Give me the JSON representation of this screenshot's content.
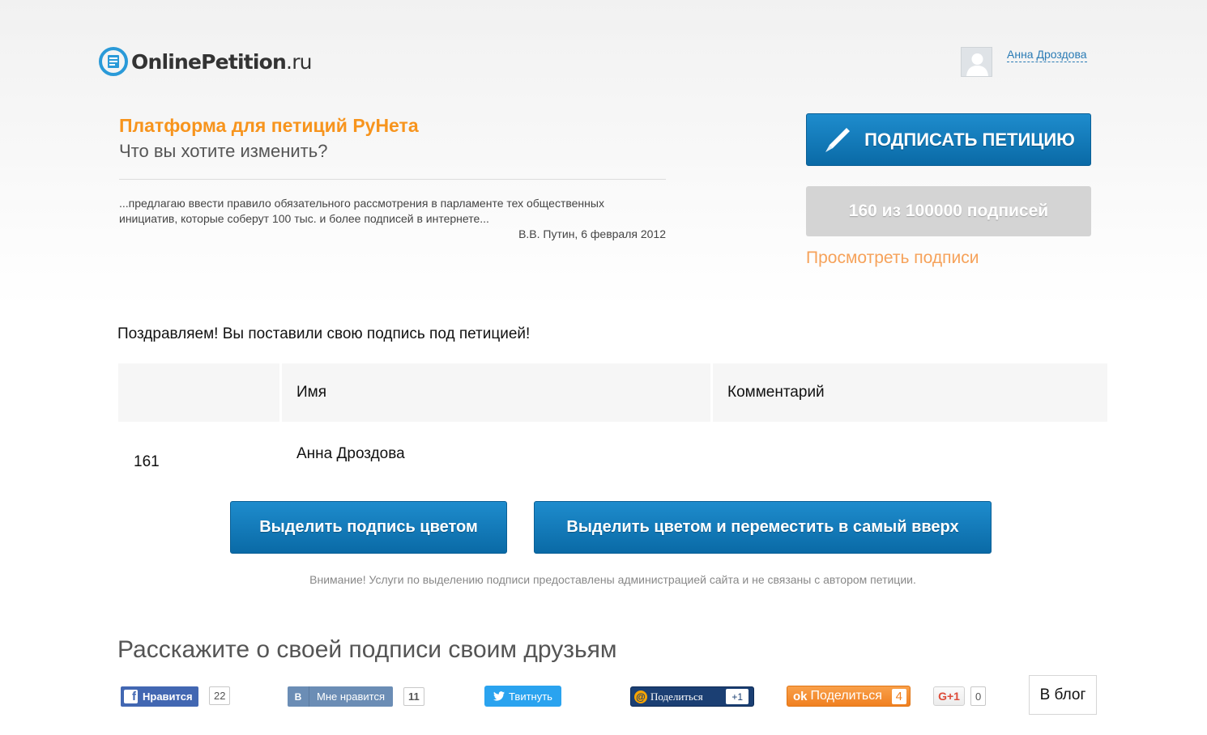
{
  "logo": {
    "brand": "OnlinePetition",
    "tld": ".ru"
  },
  "user": {
    "name": "Анна Дроздова"
  },
  "header": {
    "headline": "Платформа для петиций РуНета",
    "subhead": "Что вы хотите изменить?",
    "quote": "...предлагаю ввести правило обязательного рассмотрения в парламенте тех общественных инициатив, которые соберут 100 тыс. и более подписей в интернете...",
    "quote_author": "В.В. Путин, 6 февраля 2012"
  },
  "sidebar": {
    "sign_label": "ПОДПИСАТЬ ПЕТИЦИЮ",
    "count_label": "160 из 100000 подписей",
    "view_link": "Просмотреть подписи"
  },
  "congrats": "Поздравляем! Вы поставили свою подпись под петицией!",
  "table": {
    "columns": [
      "",
      "Имя",
      "Комментарий"
    ],
    "rows": [
      {
        "number": "161",
        "name": "Анна Дроздова",
        "comment": ""
      }
    ]
  },
  "highlight": {
    "btn1": "Выделить подпись цветом",
    "btn2": "Выделить цветом и переместить в самый вверх",
    "notice": "Внимание! Услуги по выделению подписи предоставлены администрацией сайта и не связаны с автором петиции."
  },
  "share": {
    "title": "Расскажите о своей подписи своим друзьям",
    "facebook": {
      "label": "Нравится",
      "count": "22"
    },
    "vk": {
      "label": "Мне нравится",
      "count": "11",
      "icon": "В"
    },
    "twitter": {
      "label": "Твитнуть"
    },
    "mailru": {
      "label": "Поделиться",
      "count": "+1"
    },
    "ok": {
      "label": "Поделиться",
      "count": "4"
    },
    "gplus": {
      "label": "G+1",
      "count": "0"
    },
    "blog": {
      "label": "В блог"
    }
  }
}
